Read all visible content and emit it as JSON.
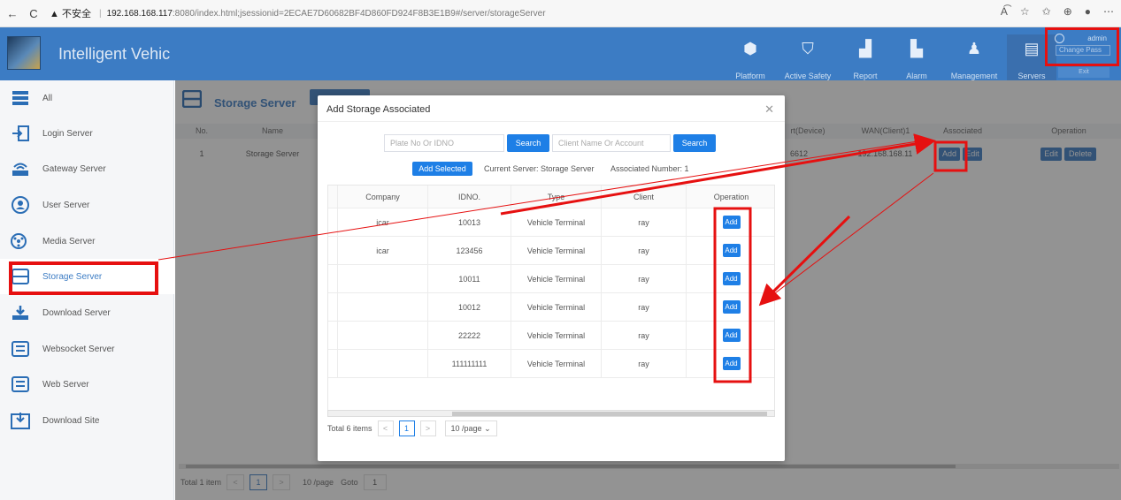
{
  "browser": {
    "back": "←",
    "reload": "C",
    "warning": "▲ 不安全",
    "host": "192.168.168.117",
    "path": ":8080/index.html;jsessionid=2ECAE7D60682BF4D860FD924F8B3E1B9#/server/storageServer",
    "icons": [
      "read-aloud-icon",
      "favorite-icon",
      "favorites-icon",
      "collections-icon",
      "profile-icon",
      "more-icon"
    ]
  },
  "header": {
    "title": "Intelligent Vehic",
    "nav": [
      {
        "label": "Platform",
        "icon": "cube-icon"
      },
      {
        "label": "Active Safety",
        "icon": "shield-icon"
      },
      {
        "label": "Report",
        "icon": "bar-chart-icon"
      },
      {
        "label": "Alarm",
        "icon": "alarm-icon"
      },
      {
        "label": "Management",
        "icon": "user-gear-icon"
      },
      {
        "label": "Servers",
        "icon": "server-icon"
      }
    ],
    "user": {
      "name": "admin",
      "change_password": "Change Pass"
    },
    "exit_label": "Exit"
  },
  "sidebar": {
    "items": [
      {
        "label": "All",
        "icon": "all-servers-icon"
      },
      {
        "label": "Login Server",
        "icon": "login-icon"
      },
      {
        "label": "Gateway Server",
        "icon": "gateway-icon"
      },
      {
        "label": "User Server",
        "icon": "user-icon"
      },
      {
        "label": "Media Server",
        "icon": "media-icon"
      },
      {
        "label": "Storage Server",
        "icon": "storage-icon"
      },
      {
        "label": "Download Server",
        "icon": "download-icon"
      },
      {
        "label": "Websocket Server",
        "icon": "websocket-icon"
      },
      {
        "label": "Web Server",
        "icon": "web-icon"
      },
      {
        "label": "Download Site",
        "icon": "download-site-icon"
      }
    ],
    "active": "Storage Server"
  },
  "main": {
    "title": "Storage Server",
    "table_headers": [
      "No.",
      "Name",
      "rt(Device)",
      "WAN(Client)1",
      "Associated",
      "Operation"
    ],
    "row": {
      "no": "1",
      "name": "Storage Server",
      "port": "6612",
      "wan": "192.168.168.11",
      "add": "Add",
      "edit": "Edit",
      "op_edit": "Edit",
      "op_delete": "Delete"
    },
    "pager": {
      "total": "Total 1 item",
      "page": "1",
      "page_size": "10 /page",
      "goto": "Goto",
      "goto_value": "1"
    }
  },
  "modal": {
    "title": "Add Storage Associated",
    "close": "✕",
    "plate_placeholder": "Plate No Or IDNO",
    "search1": "Search",
    "client_placeholder": "Client Name Or Account",
    "search2": "Search",
    "add_selected": "Add Selected",
    "current_server": "Current Server: Storage Server",
    "associated_number": "Associated Number: 1",
    "columns": [
      "Company",
      "IDNO.",
      "Type",
      "Client",
      "Operation"
    ],
    "rows": [
      {
        "company": "icar",
        "idno": "10013",
        "type": "Vehicle Terminal",
        "client": "ray",
        "op": "Add"
      },
      {
        "company": "icar",
        "idno": "123456",
        "type": "Vehicle Terminal",
        "client": "ray",
        "op": "Add"
      },
      {
        "company": "",
        "idno": "10011",
        "type": "Vehicle Terminal",
        "client": "ray",
        "op": "Add"
      },
      {
        "company": "",
        "idno": "10012",
        "type": "Vehicle Terminal",
        "client": "ray",
        "op": "Add"
      },
      {
        "company": "",
        "idno": "22222",
        "type": "Vehicle Terminal",
        "client": "ray",
        "op": "Add"
      },
      {
        "company": "",
        "idno": "111111111",
        "type": "Vehicle Terminal",
        "client": "ray",
        "op": "Add"
      }
    ],
    "pager": {
      "total": "Total 6 items",
      "prev": "<",
      "page": "1",
      "next": ">",
      "page_size": "10 /page ⌄"
    }
  },
  "colors": {
    "header_bg": "#3c7cc4",
    "primary": "#1e7fe6",
    "annotation": "#e61010"
  }
}
